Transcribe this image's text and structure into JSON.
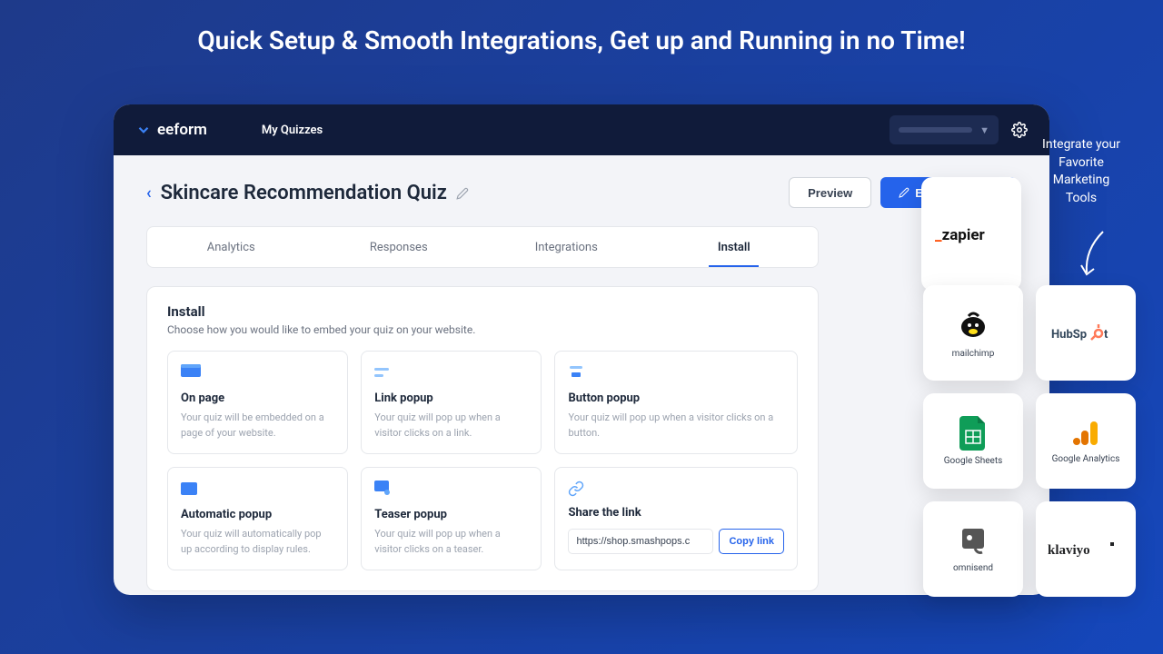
{
  "hero": {
    "title": "Quick Setup & Smooth Integrations, Get up and Running in no Time!"
  },
  "header": {
    "brand": "eeform",
    "nav_item": "My Quizzes"
  },
  "page": {
    "title": "Skincare Recommendation Quiz",
    "preview_label": "Preview",
    "edit_label": "Edit Questions",
    "tabs": [
      "Analytics",
      "Responses",
      "Integrations",
      "Install"
    ],
    "active_tab": "Install"
  },
  "install": {
    "heading": "Install",
    "subheading": "Choose how you would like to embed your quiz on your website.",
    "options": [
      {
        "title": "On page",
        "desc": "Your quiz will be embedded on a page of your website."
      },
      {
        "title": "Link popup",
        "desc": "Your quiz will pop up when a visitor clicks on a link."
      },
      {
        "title": "Button popup",
        "desc": "Your quiz will pop up when a visitor clicks on a button."
      },
      {
        "title": "Automatic popup",
        "desc": "Your quiz will automatically pop up according to display rules."
      },
      {
        "title": "Teaser popup",
        "desc": "Your quiz will pop up when a visitor clicks on a teaser."
      }
    ],
    "share": {
      "title": "Share the link",
      "url": "https://shop.smashpops.c",
      "copy_label": "Copy link"
    }
  },
  "sidebar": {
    "text": "Integrate your Favorite Marketing Tools"
  },
  "integrations": {
    "featured": "zapier",
    "cards": [
      {
        "label": "mailchimp"
      },
      {
        "label": "HubSpot"
      },
      {
        "label": "Google Sheets"
      },
      {
        "label": "Google Analytics"
      },
      {
        "label": "omnisend"
      },
      {
        "label": "klaviyo"
      }
    ]
  }
}
